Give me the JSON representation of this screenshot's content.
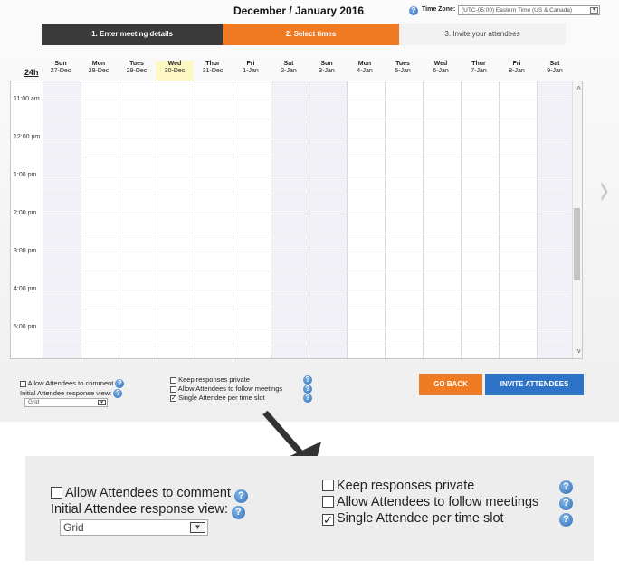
{
  "header": {
    "title": "December / January 2016",
    "timezone_label": "Time Zone:",
    "timezone_value": "(UTC-05:00) Eastern Time (US & Canada)"
  },
  "steps": [
    {
      "label": "1. Enter meeting details"
    },
    {
      "label": "2. Select times"
    },
    {
      "label": "3. Invite your attendees"
    }
  ],
  "calendar": {
    "format_toggle": "24h",
    "days": [
      {
        "name": "Sun",
        "date": "27-Dec"
      },
      {
        "name": "Mon",
        "date": "28-Dec"
      },
      {
        "name": "Tues",
        "date": "29-Dec"
      },
      {
        "name": "Wed",
        "date": "30-Dec"
      },
      {
        "name": "Thur",
        "date": "31-Dec"
      },
      {
        "name": "Fri",
        "date": "1-Jan"
      },
      {
        "name": "Sat",
        "date": "2-Jan"
      },
      {
        "name": "Sun",
        "date": "3-Jan"
      },
      {
        "name": "Mon",
        "date": "4-Jan"
      },
      {
        "name": "Tues",
        "date": "5-Jan"
      },
      {
        "name": "Wed",
        "date": "6-Jan"
      },
      {
        "name": "Thur",
        "date": "7-Jan"
      },
      {
        "name": "Fri",
        "date": "8-Jan"
      },
      {
        "name": "Sat",
        "date": "9-Jan"
      }
    ],
    "times": [
      "11:00 am",
      "12:00 pm",
      "1:00 pm",
      "2:00 pm",
      "3:00 pm",
      "4:00 pm",
      "5:00 pm"
    ]
  },
  "options": {
    "allow_comment": {
      "label": "Allow Attendees to comment",
      "checked": false
    },
    "response_view_label": "Initial Attendee response view:",
    "response_view_value": "Grid",
    "keep_private": {
      "label": "Keep responses private",
      "checked": false
    },
    "follow_meetings": {
      "label": "Allow Attendees to follow meetings",
      "checked": false
    },
    "single_attendee": {
      "label": "Single Attendee per time slot",
      "checked": true
    }
  },
  "buttons": {
    "go_back": "GO BACK",
    "invite": "INVITE ATTENDEES"
  },
  "icons": {
    "help": "?",
    "check": "✓",
    "dropdown": "▼",
    "scroll_up": "˄",
    "scroll_down": "˅",
    "next": "›"
  },
  "colors": {
    "step_active": "#f07a22",
    "step_done": "#3a3a3a",
    "go_back": "#ef7b22",
    "invite": "#2f73c9",
    "today_highlight": "#fdf7c3"
  }
}
